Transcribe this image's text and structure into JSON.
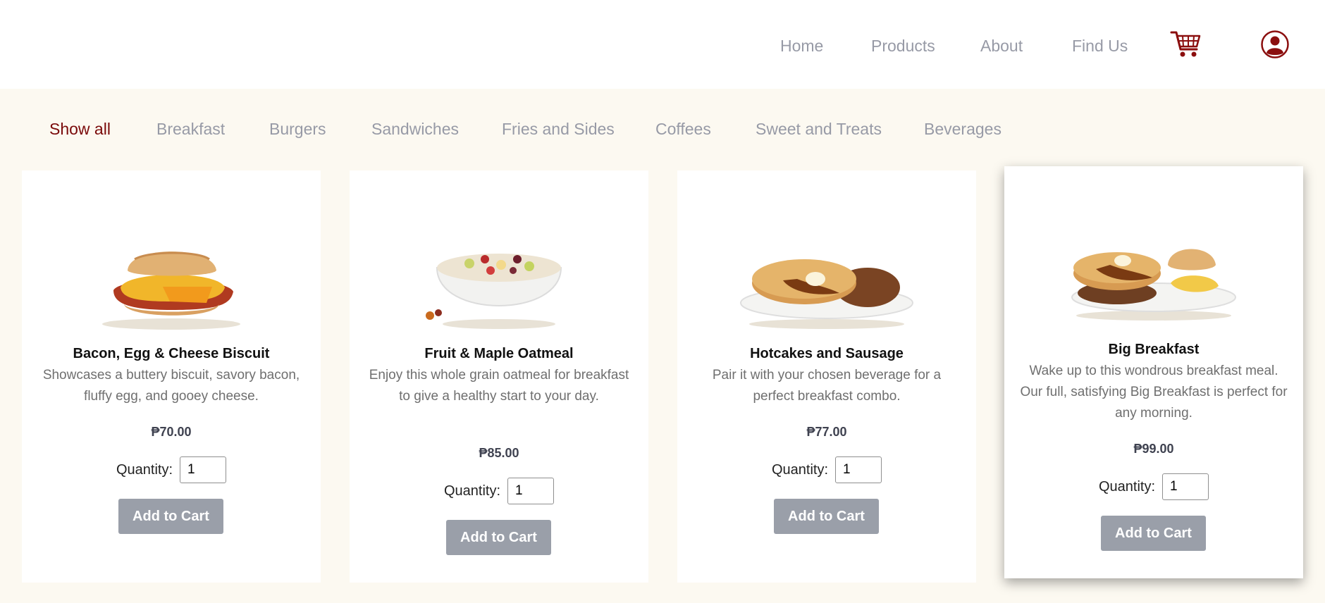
{
  "nav": {
    "links": [
      "Home",
      "Products",
      "About",
      "Find Us"
    ],
    "cart_icon": "cart-icon",
    "profile_icon": "user-profile-icon"
  },
  "filters": [
    "Show all",
    "Breakfast",
    "Burgers",
    "Sandwiches",
    "Fries and Sides",
    "Coffees",
    "Sweet and Treats",
    "Beverages"
  ],
  "active_filter": "Show all",
  "colors": {
    "accent": "#7a0a0a",
    "muted": "#979aa6",
    "button": "#9a9fa9",
    "background": "#fcf9f1"
  },
  "quantity_label": "Quantity:",
  "add_button_label": "Add to Cart",
  "products": [
    {
      "name": "Bacon, Egg & Cheese Biscuit",
      "description": "Showcases a buttery biscuit, savory bacon, fluffy egg, and gooey cheese.",
      "price": "₱70.00",
      "quantity": "1"
    },
    {
      "name": "Fruit & Maple Oatmeal",
      "description": "Enjoy this whole grain oatmeal for breakfast to give a healthy start to your day.",
      "price": "₱85.00",
      "quantity": "1"
    },
    {
      "name": "Hotcakes and Sausage",
      "description": "Pair it with your chosen beverage for a perfect breakfast combo.",
      "price": "₱77.00",
      "quantity": "1"
    },
    {
      "name": "Big Breakfast",
      "description": "Wake up to this wondrous breakfast meal. Our full, satisfying Big Breakfast is perfect for any morning.",
      "price": "₱99.00",
      "quantity": "1"
    }
  ]
}
